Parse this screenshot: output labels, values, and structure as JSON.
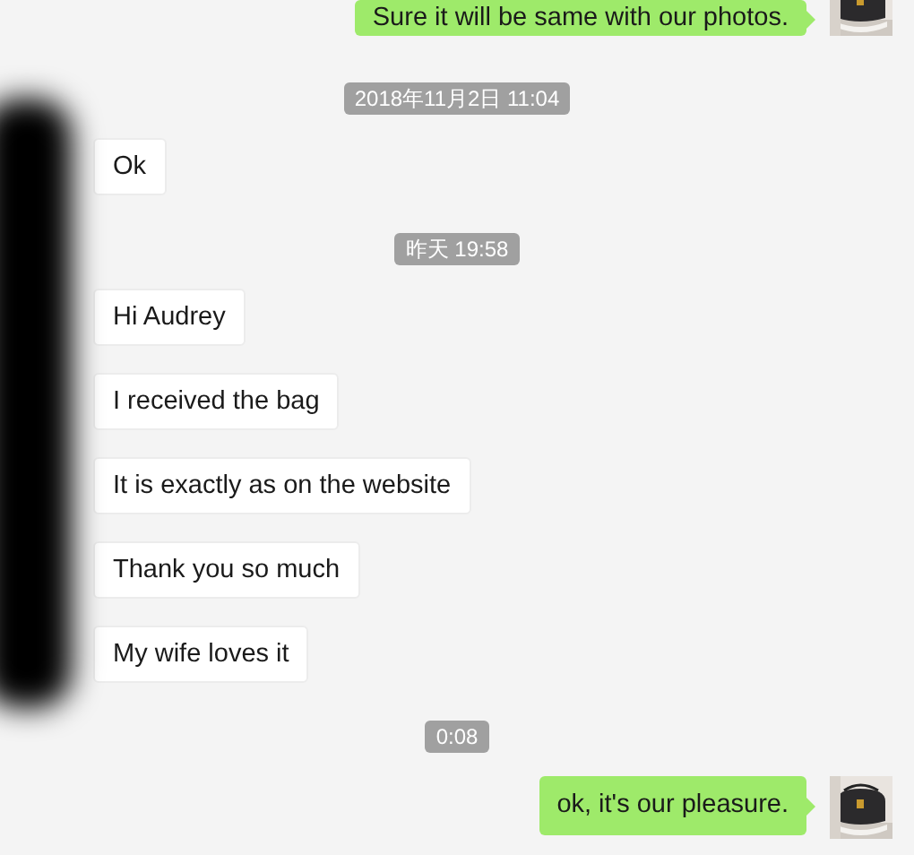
{
  "messages": [
    {
      "kind": "sent",
      "text": "Sure it will be same with our photos."
    },
    {
      "kind": "time",
      "text": "2018年11月2日 11:04"
    },
    {
      "kind": "received",
      "text": "Ok"
    },
    {
      "kind": "time",
      "text": "昨天 19:58"
    },
    {
      "kind": "received",
      "text": "Hi Audrey"
    },
    {
      "kind": "received",
      "text": "I received the bag"
    },
    {
      "kind": "received",
      "text": "It is exactly as on the website"
    },
    {
      "kind": "received",
      "text": "Thank you so much"
    },
    {
      "kind": "received",
      "text": "My wife loves it"
    },
    {
      "kind": "time",
      "text": "0:08"
    },
    {
      "kind": "sent",
      "text": "ok, it's our pleasure."
    }
  ]
}
